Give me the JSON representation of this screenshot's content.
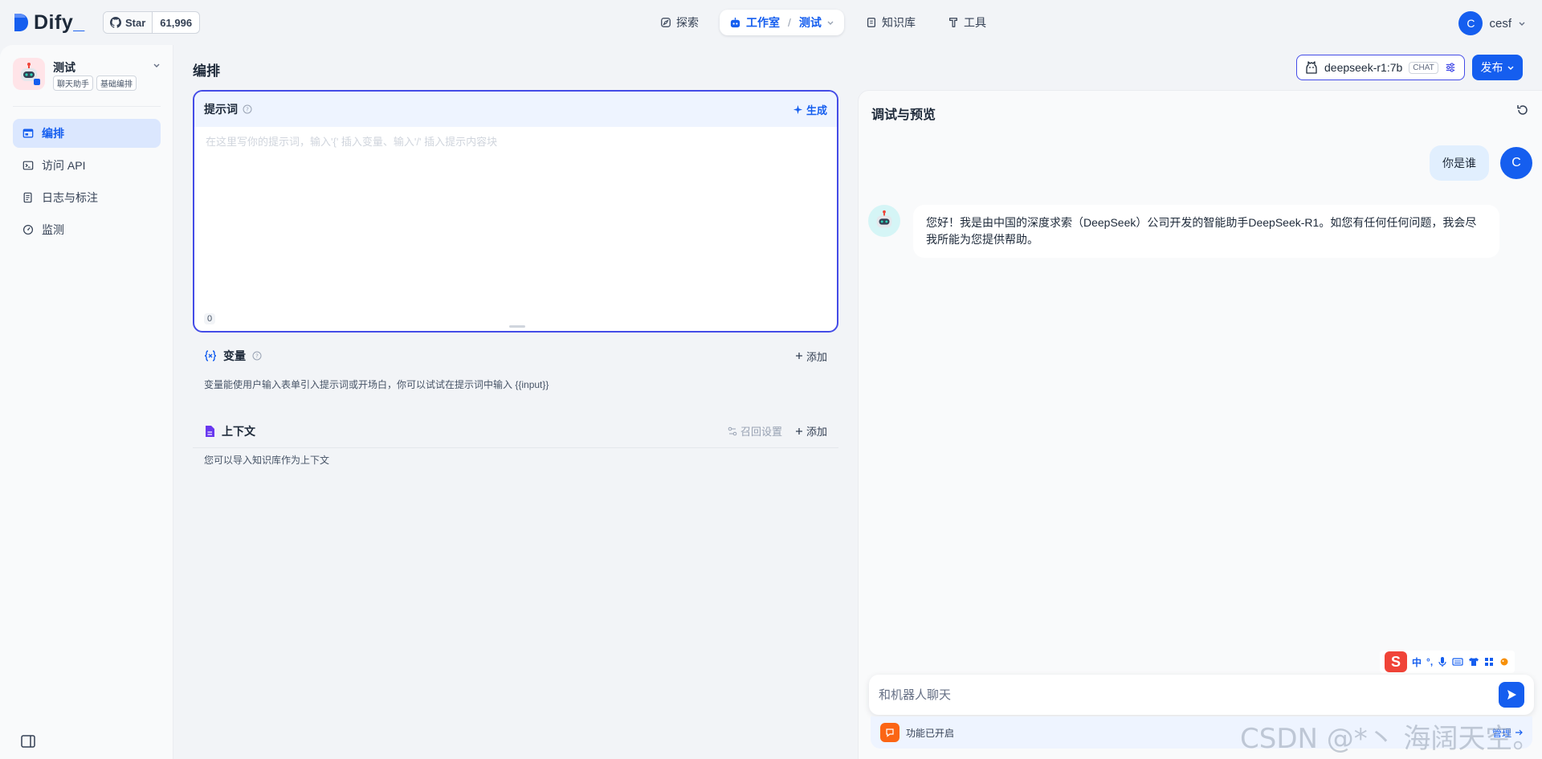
{
  "topbar": {
    "logo": "Dify",
    "github": {
      "star_label": "Star",
      "count": "61,996"
    },
    "nav": {
      "explore": "探索",
      "studio": "工作室",
      "studio_app": "测试",
      "knowledge": "知识库",
      "tools": "工具"
    },
    "user": {
      "initial": "C",
      "name": "cesf"
    }
  },
  "sidebar": {
    "app": {
      "name": "测试",
      "tags": [
        "聊天助手",
        "基础编排"
      ]
    },
    "menu": [
      {
        "label": "编排",
        "icon": "layout-icon",
        "active": true
      },
      {
        "label": "访问 API",
        "icon": "terminal-icon",
        "active": false
      },
      {
        "label": "日志与标注",
        "icon": "file-list-icon",
        "active": false
      },
      {
        "label": "监测",
        "icon": "gauge-icon",
        "active": false
      }
    ]
  },
  "main": {
    "title": "编排",
    "model": {
      "name": "deepseek-r1:7b",
      "mode": "CHAT"
    },
    "publish_label": "发布",
    "prompt": {
      "title": "提示词",
      "generate_label": "生成",
      "placeholder": "在这里写你的提示词，输入'{' 插入变量、输入'/' 插入提示内容块",
      "char_count": "0"
    },
    "variables": {
      "title": "变量",
      "add_label": "添加",
      "description": "变量能使用户输入表单引入提示词或开场白，你可以试试在提示词中输入 {{input}}"
    },
    "context": {
      "title": "上下文",
      "retrieval_label": "召回设置",
      "add_label": "添加",
      "description": "您可以导入知识库作为上下文"
    }
  },
  "debug": {
    "title": "调试与预览",
    "question": "你是谁",
    "user_initial": "C",
    "answer": "您好！我是由中国的深度求索（DeepSeek）公司开发的智能助手DeepSeek-R1。如您有任何任何问题，我会尽我所能为您提供帮助。",
    "input_placeholder": "和机器人聊天",
    "features_label": "功能已开启",
    "manage_label": "管理",
    "ime": {
      "s": "S",
      "lang": "中",
      "punct": "°,"
    }
  },
  "watermark": "CSDN @*丶 海阔天空。",
  "colors": {
    "accent": "#155eef",
    "border_active": "#444ce7",
    "bg": "#f2f4f7"
  }
}
